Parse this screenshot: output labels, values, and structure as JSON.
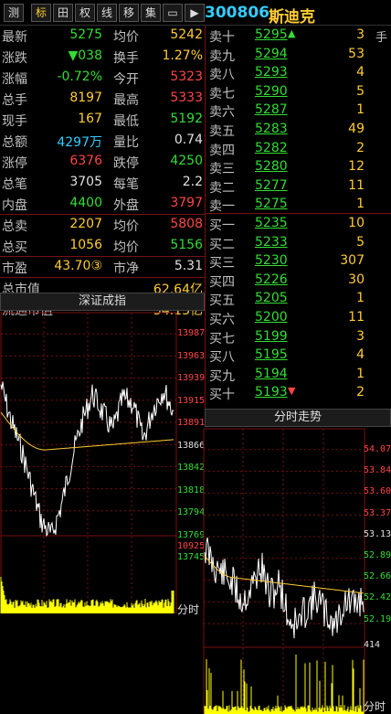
{
  "toolbar": {
    "tabs": [
      "测",
      "标",
      "田",
      "权",
      "线",
      "移",
      "集",
      "▭",
      "▶"
    ],
    "code": "300806",
    "name": "斯迪克"
  },
  "quote": [
    {
      "l1": "最新",
      "v1": "5275",
      "c1": "green",
      "l2": "均价",
      "v2": "5242",
      "c2": "yellow"
    },
    {
      "l1": "涨跌",
      "v1": "▼038",
      "c1": "green",
      "l2": "换手",
      "v2": "1.27%",
      "c2": "yellow"
    },
    {
      "l1": "涨幅",
      "v1": "-0.72%",
      "c1": "green",
      "l2": "今开",
      "v2": "5323",
      "c2": "red"
    },
    {
      "l1": "总手",
      "v1": "8197",
      "c1": "yellow",
      "l2": "最高",
      "v2": "5333",
      "c2": "red"
    },
    {
      "l1": "现手",
      "v1": "167",
      "c1": "yellow",
      "l2": "最低",
      "v2": "5192",
      "c2": "green"
    },
    {
      "l1": "总额",
      "v1": "4297万",
      "c1": "cyan",
      "l2": "量比",
      "v2": "0.74",
      "c2": "white"
    },
    {
      "l1": "涨停",
      "v1": "6376",
      "c1": "red",
      "l2": "跌停",
      "v2": "4250",
      "c2": "green"
    },
    {
      "l1": "总笔",
      "v1": "3705",
      "c1": "white",
      "l2": "每笔",
      "v2": "2.2",
      "c2": "white"
    },
    {
      "l1": "内盘",
      "v1": "4400",
      "c1": "green",
      "l2": "外盘",
      "v2": "3797",
      "c2": "red"
    },
    {
      "l1": "总卖",
      "v1": "2207",
      "c1": "yellow",
      "l2": "均价",
      "v2": "5808",
      "c2": "red"
    },
    {
      "l1": "总买",
      "v1": "1056",
      "c1": "yellow",
      "l2": "均价",
      "v2": "5156",
      "c2": "green"
    },
    {
      "l1": "市盈",
      "v1": "43.70③",
      "c1": "yellow",
      "l2": "市净",
      "v2": "5.31",
      "c2": "white"
    },
    {
      "l1": "总市值",
      "v1": "",
      "c1": "white",
      "l2": "",
      "v2": "62.64亿",
      "c2": "yellow"
    },
    {
      "l1": "流通市值",
      "v1": "",
      "c1": "white",
      "l2": "",
      "v2": "34.13亿",
      "c2": "yellow"
    }
  ],
  "orderbook": [
    {
      "label": "卖十",
      "price": "5295",
      "vol": "3",
      "mark": "up"
    },
    {
      "label": "卖九",
      "price": "5294",
      "vol": "53",
      "mark": ""
    },
    {
      "label": "卖八",
      "price": "5293",
      "vol": "4",
      "mark": ""
    },
    {
      "label": "卖七",
      "price": "5290",
      "vol": "5",
      "mark": ""
    },
    {
      "label": "卖六",
      "price": "5287",
      "vol": "1",
      "mark": ""
    },
    {
      "label": "卖五",
      "price": "5283",
      "vol": "49",
      "mark": ""
    },
    {
      "label": "卖四",
      "price": "5282",
      "vol": "2",
      "mark": ""
    },
    {
      "label": "卖三",
      "price": "5280",
      "vol": "12",
      "mark": ""
    },
    {
      "label": "卖二",
      "price": "5277",
      "vol": "11",
      "mark": ""
    },
    {
      "label": "卖一",
      "price": "5275",
      "vol": "1",
      "mark": ""
    },
    {
      "label": "买一",
      "price": "5235",
      "vol": "10",
      "mark": ""
    },
    {
      "label": "买二",
      "price": "5233",
      "vol": "5",
      "mark": ""
    },
    {
      "label": "买三",
      "price": "5230",
      "vol": "307",
      "mark": ""
    },
    {
      "label": "买四",
      "price": "5226",
      "vol": "30",
      "mark": ""
    },
    {
      "label": "买五",
      "price": "5205",
      "vol": "1",
      "mark": ""
    },
    {
      "label": "买六",
      "price": "5200",
      "vol": "11",
      "mark": ""
    },
    {
      "label": "买七",
      "price": "5199",
      "vol": "3",
      "mark": ""
    },
    {
      "label": "买八",
      "price": "5195",
      "vol": "4",
      "mark": ""
    },
    {
      "label": "买九",
      "price": "5194",
      "vol": "1",
      "mark": ""
    },
    {
      "label": "买十",
      "price": "5193",
      "vol": "2",
      "mark": "down"
    }
  ],
  "orderbook_extra": "手",
  "index_chart": {
    "title": "深证成指",
    "price_labels": [
      "13987",
      "13963",
      "13939",
      "13915",
      "13891",
      "13866",
      "13842",
      "13818",
      "13794",
      "13769",
      "13745"
    ],
    "volume_label": "10925",
    "time_label": "分时"
  },
  "stock_chart": {
    "title": "分时走势",
    "price_labels": [
      "54.07",
      "53.84",
      "53.60",
      "53.37",
      "53.13",
      "52.89",
      "52.66",
      "52.42",
      "52.19"
    ],
    "volume_label": "414",
    "time_label": "分时"
  },
  "colors": {
    "up": "#ff4444",
    "down": "#33dd33",
    "avg": "#ffcc33",
    "border": "#7a1010"
  }
}
